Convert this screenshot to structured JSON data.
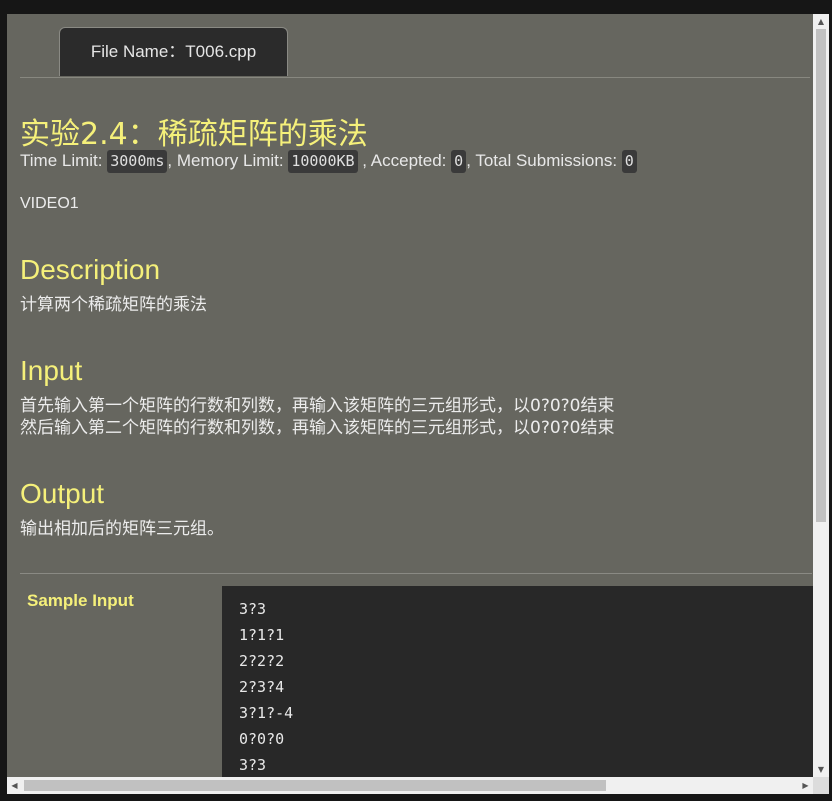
{
  "tab": {
    "label": "File Name：T006.cpp"
  },
  "problem": {
    "title": "实验2.4：稀疏矩阵的乘法",
    "time_limit_label": "Time Limit:",
    "time_limit": "3000ms",
    "memory_limit_label": ", Memory Limit:",
    "memory_limit": "10000KB",
    "accepted_label": ", Accepted:",
    "accepted": "0",
    "submissions_label": ", Total Submissions:",
    "submissions": "0",
    "video": "VIDEO1"
  },
  "description": {
    "heading": "Description",
    "text": "计算两个稀疏矩阵的乘法"
  },
  "input": {
    "heading": "Input",
    "lines": [
      "首先输入第一个矩阵的行数和列数，再输入该矩阵的三元组形式，以0?0?0结束",
      "然后输入第二个矩阵的行数和列数，再输入该矩阵的三元组形式，以0?0?0结束"
    ]
  },
  "output": {
    "heading": "Output",
    "text": "输出相加后的矩阵三元组。"
  },
  "sample_input": {
    "label": "Sample Input",
    "lines": [
      "3?3",
      "1?1?1",
      "2?2?2",
      "2?3?4",
      "3?1?-4",
      "0?0?0",
      "3?3"
    ]
  },
  "scrollbar": {
    "vertical_icon_up": "triangle-up-icon",
    "vertical_icon_down": "triangle-down-icon"
  }
}
